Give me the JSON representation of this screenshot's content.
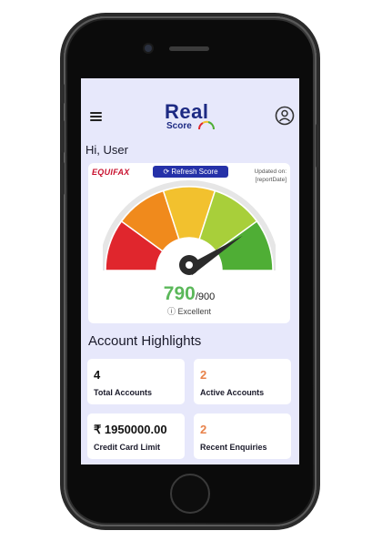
{
  "header": {
    "logo_main": "Real",
    "logo_sub": "Score"
  },
  "greeting": "Hi, User",
  "score_card": {
    "bureau": "EQUIFAX",
    "refresh_label": "Refresh Score",
    "updated_label": "Updated on:",
    "updated_value": "[reportDate]",
    "score": "790",
    "max_score": "/900",
    "rating": "Excellent"
  },
  "gauge": {
    "min": 300,
    "max": 900,
    "value": 790,
    "segments": [
      "#e0262d",
      "#f08a1c",
      "#f2c12e",
      "#a8cf3a",
      "#4fae35"
    ]
  },
  "highlights": {
    "title": "Account Highlights",
    "tiles": [
      {
        "value": "4",
        "label": "Total Accounts",
        "color": "#111111"
      },
      {
        "value": "2",
        "label": "Active Accounts",
        "color": "#e8824a"
      },
      {
        "value": "₹ 1950000.00",
        "label": "Credit Card Limit",
        "color": "#111111"
      },
      {
        "value": "2",
        "label": "Recent Enquiries",
        "color": "#e8824a"
      }
    ]
  }
}
